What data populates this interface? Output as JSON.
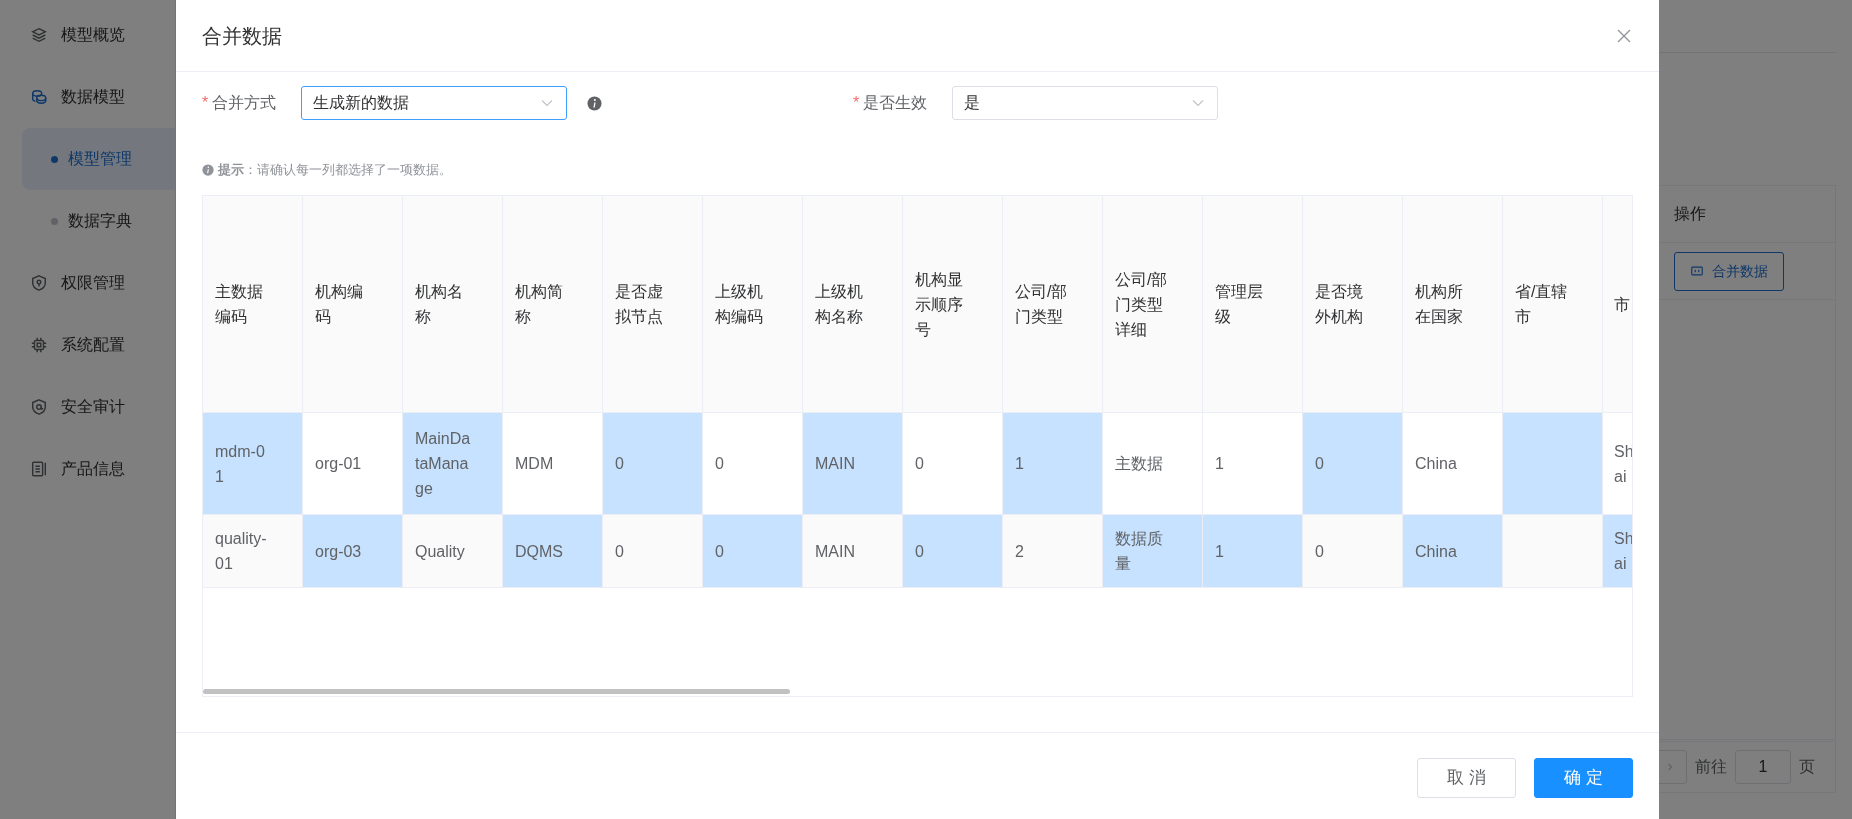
{
  "sidebar": {
    "items": [
      {
        "label": "模型概览",
        "selected": false
      },
      {
        "label": "数据模型",
        "selected": true,
        "children": [
          {
            "label": "模型管理",
            "selected": true
          },
          {
            "label": "数据字典",
            "selected": false
          }
        ]
      },
      {
        "label": "权限管理",
        "selected": false
      },
      {
        "label": "系统配置",
        "selected": false
      },
      {
        "label": "安全审计",
        "selected": false
      },
      {
        "label": "产品信息",
        "selected": false
      }
    ]
  },
  "background_table": {
    "columns": [
      "操作"
    ],
    "rows": [
      {
        "action": "合并数据"
      }
    ]
  },
  "pagination": {
    "goto_label": "前往",
    "page": "1",
    "page_suffix": "页"
  },
  "dialog": {
    "title": "合并数据",
    "fields": [
      {
        "label": "合并方式",
        "required_mark": "*",
        "value": "生成新的数据",
        "focused": true,
        "info": true
      },
      {
        "label": "是否生效",
        "required_mark": "*",
        "value": "是",
        "focused": false,
        "info": false
      }
    ],
    "hint": "**提示**：请确认每一列都选择了一项数据。",
    "table": {
      "columns": [
        "主数据编码",
        "机构编码",
        "机构名称",
        "机构简称",
        "是否虚拟节点",
        "上级机构编码",
        "上级机构名称",
        "机构显示顺序号",
        "公司/部门类型",
        "公司/部门类型详细",
        "管理层级",
        "是否境外机构",
        "机构所在国家",
        "省/直辖市",
        "市"
      ],
      "rows": [
        {
          "cells": [
            {
              "text": "mdm-01",
              "selected": true
            },
            {
              "text": "org-01",
              "selected": false
            },
            {
              "text": "MainDataManage",
              "selected": true
            },
            {
              "text": "MDM",
              "selected": false
            },
            {
              "text": "0",
              "selected": true
            },
            {
              "text": "0",
              "selected": false
            },
            {
              "text": "MAIN",
              "selected": true
            },
            {
              "text": "0",
              "selected": false
            },
            {
              "text": "1",
              "selected": true
            },
            {
              "text": "主数据",
              "selected": false
            },
            {
              "text": "1",
              "selected": false
            },
            {
              "text": "0",
              "selected": true
            },
            {
              "text": "China",
              "selected": false
            },
            {
              "selected": true
            },
            {
              "text": "Sh ai",
              "selected": false
            }
          ]
        },
        {
          "cells": [
            {
              "text": "quality-01",
              "selected": false
            },
            {
              "text": "org-03",
              "selected": true
            },
            {
              "text": "Quality",
              "selected": false
            },
            {
              "text": "DQMS",
              "selected": true
            },
            {
              "text": "0",
              "selected": false
            },
            {
              "text": "0",
              "selected": true
            },
            {
              "text": "MAIN",
              "selected": false
            },
            {
              "text": "0",
              "selected": true
            },
            {
              "text": "2",
              "selected": false
            },
            {
              "text": "数据质量",
              "selected": true
            },
            {
              "text": "1",
              "selected": true
            },
            {
              "text": "0",
              "selected": false
            },
            {
              "text": "China",
              "selected": true
            },
            {
              "selected": false
            },
            {
              "text": "Sh ai",
              "selected": true
            }
          ]
        }
      ]
    },
    "buttons": [
      {
        "label": "取 消",
        "kind": "default"
      },
      {
        "label": "确 定",
        "kind": "primary"
      }
    ]
  }
}
